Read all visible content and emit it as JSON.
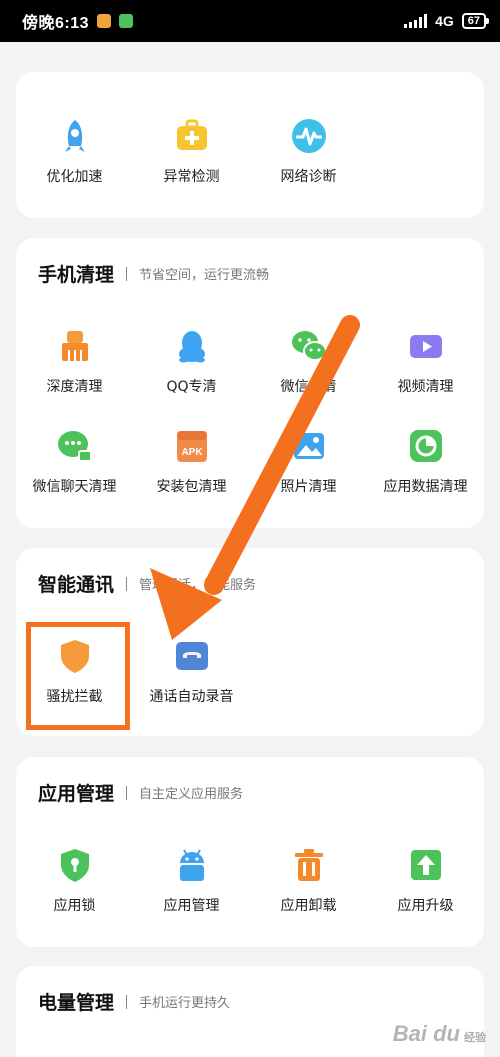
{
  "status_bar": {
    "time": "傍晚6:13",
    "network": "4G",
    "battery": "67"
  },
  "section_tools": {
    "items": [
      {
        "label": "优化加速",
        "icon": "rocket-icon"
      },
      {
        "label": "异常检测",
        "icon": "medkit-icon"
      },
      {
        "label": "网络诊断",
        "icon": "pulse-icon"
      }
    ]
  },
  "section_clean": {
    "title": "手机清理",
    "subtitle": "节省空间，运行更流畅",
    "items": [
      {
        "label": "深度清理",
        "icon": "broom-icon"
      },
      {
        "label": "QQ专清",
        "icon": "qq-penguin-icon"
      },
      {
        "label": "微信专清",
        "icon": "wechat-icon"
      },
      {
        "label": "视频清理",
        "icon": "video-icon"
      },
      {
        "label": "微信聊天清理",
        "icon": "chat-icon"
      },
      {
        "label": "安装包清理",
        "icon": "apk-icon"
      },
      {
        "label": "照片清理",
        "icon": "photo-icon"
      },
      {
        "label": "应用数据清理",
        "icon": "pie-chart-icon"
      }
    ]
  },
  "section_comm": {
    "title": "智能通讯",
    "subtitle": "管理通话，智能服务",
    "items": [
      {
        "label": "骚扰拦截",
        "icon": "shield-icon"
      },
      {
        "label": "通话自动录音",
        "icon": "call-record-icon"
      }
    ]
  },
  "section_apps": {
    "title": "应用管理",
    "subtitle": "自主定义应用服务",
    "items": [
      {
        "label": "应用锁",
        "icon": "lock-icon"
      },
      {
        "label": "应用管理",
        "icon": "android-icon"
      },
      {
        "label": "应用卸载",
        "icon": "trash-icon"
      },
      {
        "label": "应用升级",
        "icon": "upgrade-icon"
      }
    ]
  },
  "section_power": {
    "title": "电量管理",
    "subtitle": "手机运行更持久"
  },
  "watermark": {
    "brand": "Bai du",
    "sub": "经验"
  },
  "colors": {
    "accent_orange": "#f3701f",
    "blue": "#3fa4f0",
    "green": "#4cc35a",
    "yellow": "#f7c531",
    "purple": "#8a7cf0"
  }
}
